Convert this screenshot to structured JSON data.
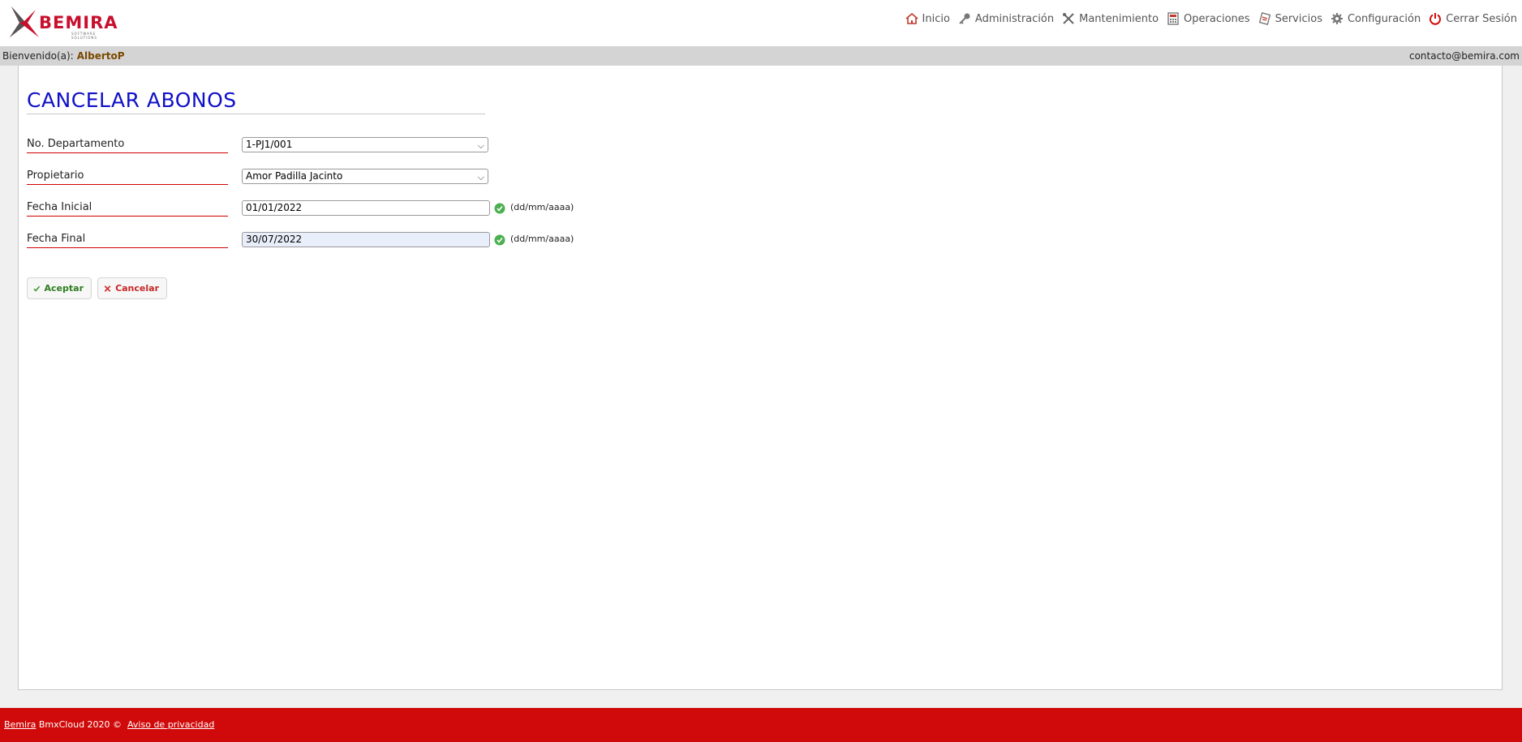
{
  "brand": {
    "logo_text": "BEMIRA",
    "logo_sub": "SOFTWARE SOLUTIONS"
  },
  "nav": [
    {
      "label": "Inicio",
      "icon": "home-icon"
    },
    {
      "label": "Administración",
      "icon": "key-icon"
    },
    {
      "label": "Mantenimiento",
      "icon": "tools-icon"
    },
    {
      "label": "Operaciones",
      "icon": "calculator-icon"
    },
    {
      "label": "Servicios",
      "icon": "services-icon"
    },
    {
      "label": "Configuración",
      "icon": "gear-icon"
    },
    {
      "label": "Cerrar Sesión",
      "icon": "power-icon"
    }
  ],
  "welcome": {
    "prefix": "Bienvenido(a):",
    "user": "AlbertoP",
    "contact": "contacto@bemira.com"
  },
  "page": {
    "title": "CANCELAR ABONOS",
    "fields": {
      "departamento": {
        "label": "No. Departamento",
        "value": "1-PJ1/001"
      },
      "propietario": {
        "label": "Propietario",
        "value": "Amor Padilla Jacinto"
      },
      "fecha_inicial": {
        "label": "Fecha Inicial",
        "value": "01/01/2022",
        "hint": "(dd/mm/aaaa)"
      },
      "fecha_final": {
        "label": "Fecha Final",
        "value": "30/07/2022",
        "hint": "(dd/mm/aaaa)"
      }
    },
    "buttons": {
      "accept": "Aceptar",
      "cancel": "Cancelar"
    }
  },
  "footer": {
    "brand_link": "Bemira",
    "text": "BmxCloud 2020 ©",
    "privacy_link": "Aviso de privacidad"
  },
  "colors": {
    "accent_red": "#d00a0a",
    "title_blue": "#1010c8"
  }
}
